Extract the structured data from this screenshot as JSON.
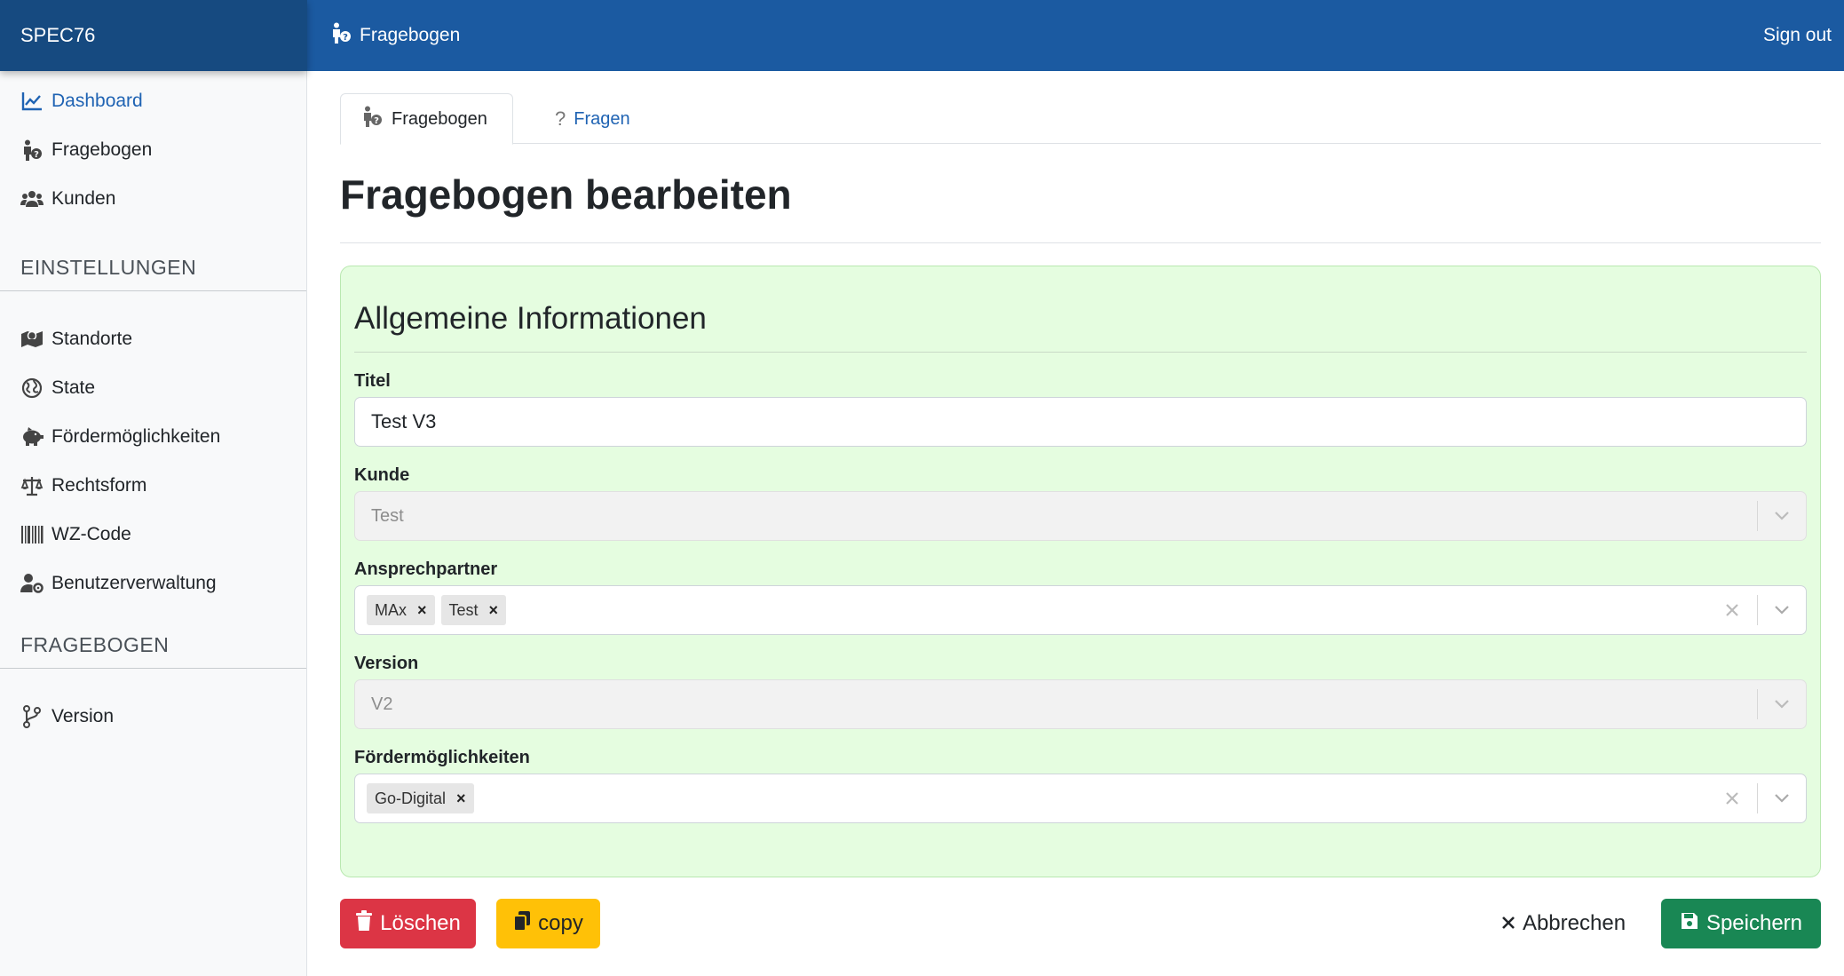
{
  "brand": "SPEC76",
  "topbar": {
    "title": "Fragebogen",
    "signout": "Sign out"
  },
  "sidebar": {
    "main_items": [
      {
        "label": "Dashboard",
        "icon": "chart-line-icon",
        "active": true
      },
      {
        "label": "Fragebogen",
        "icon": "person-question-icon"
      },
      {
        "label": "Kunden",
        "icon": "users-icon"
      }
    ],
    "section_settings": "EINSTELLUNGEN",
    "settings_items": [
      {
        "label": "Standorte",
        "icon": "map-marker-icon"
      },
      {
        "label": "State",
        "icon": "globe-icon"
      },
      {
        "label": "Fördermöglichkeiten",
        "icon": "piggy-bank-icon"
      },
      {
        "label": "Rechtsform",
        "icon": "scale-icon"
      },
      {
        "label": "WZ-Code",
        "icon": "barcode-icon"
      },
      {
        "label": "Benutzerverwaltung",
        "icon": "user-gear-icon"
      }
    ],
    "section_questionnaire": "FRAGEBOGEN",
    "questionnaire_items": [
      {
        "label": "Version",
        "icon": "code-branch-icon"
      }
    ]
  },
  "tabs": [
    {
      "label": "Fragebogen",
      "icon": "person-question-icon",
      "active": true
    },
    {
      "label": "Fragen",
      "icon": "question-icon",
      "active": false
    }
  ],
  "page_title": "Fragebogen bearbeiten",
  "card": {
    "title": "Allgemeine Informationen",
    "fields": {
      "titel": {
        "label": "Titel",
        "value": "Test V3"
      },
      "kunde": {
        "label": "Kunde",
        "value": "Test"
      },
      "ansprechpartner": {
        "label": "Ansprechpartner",
        "chips": [
          "MAx",
          "Test"
        ]
      },
      "version": {
        "label": "Version",
        "value": "V2"
      },
      "foerder": {
        "label": "Fördermöglichkeiten",
        "chips": [
          "Go-Digital"
        ]
      }
    }
  },
  "actions": {
    "delete": "Löschen",
    "copy": "copy",
    "cancel": "Abbrechen",
    "save": "Speichern"
  },
  "colors": {
    "brand": "#164a80",
    "topbar": "#1b5aa1",
    "link": "#1f63b3",
    "card_bg": "#e5fde0",
    "danger": "#dc3545",
    "warning": "#ffc107",
    "success": "#198754"
  }
}
